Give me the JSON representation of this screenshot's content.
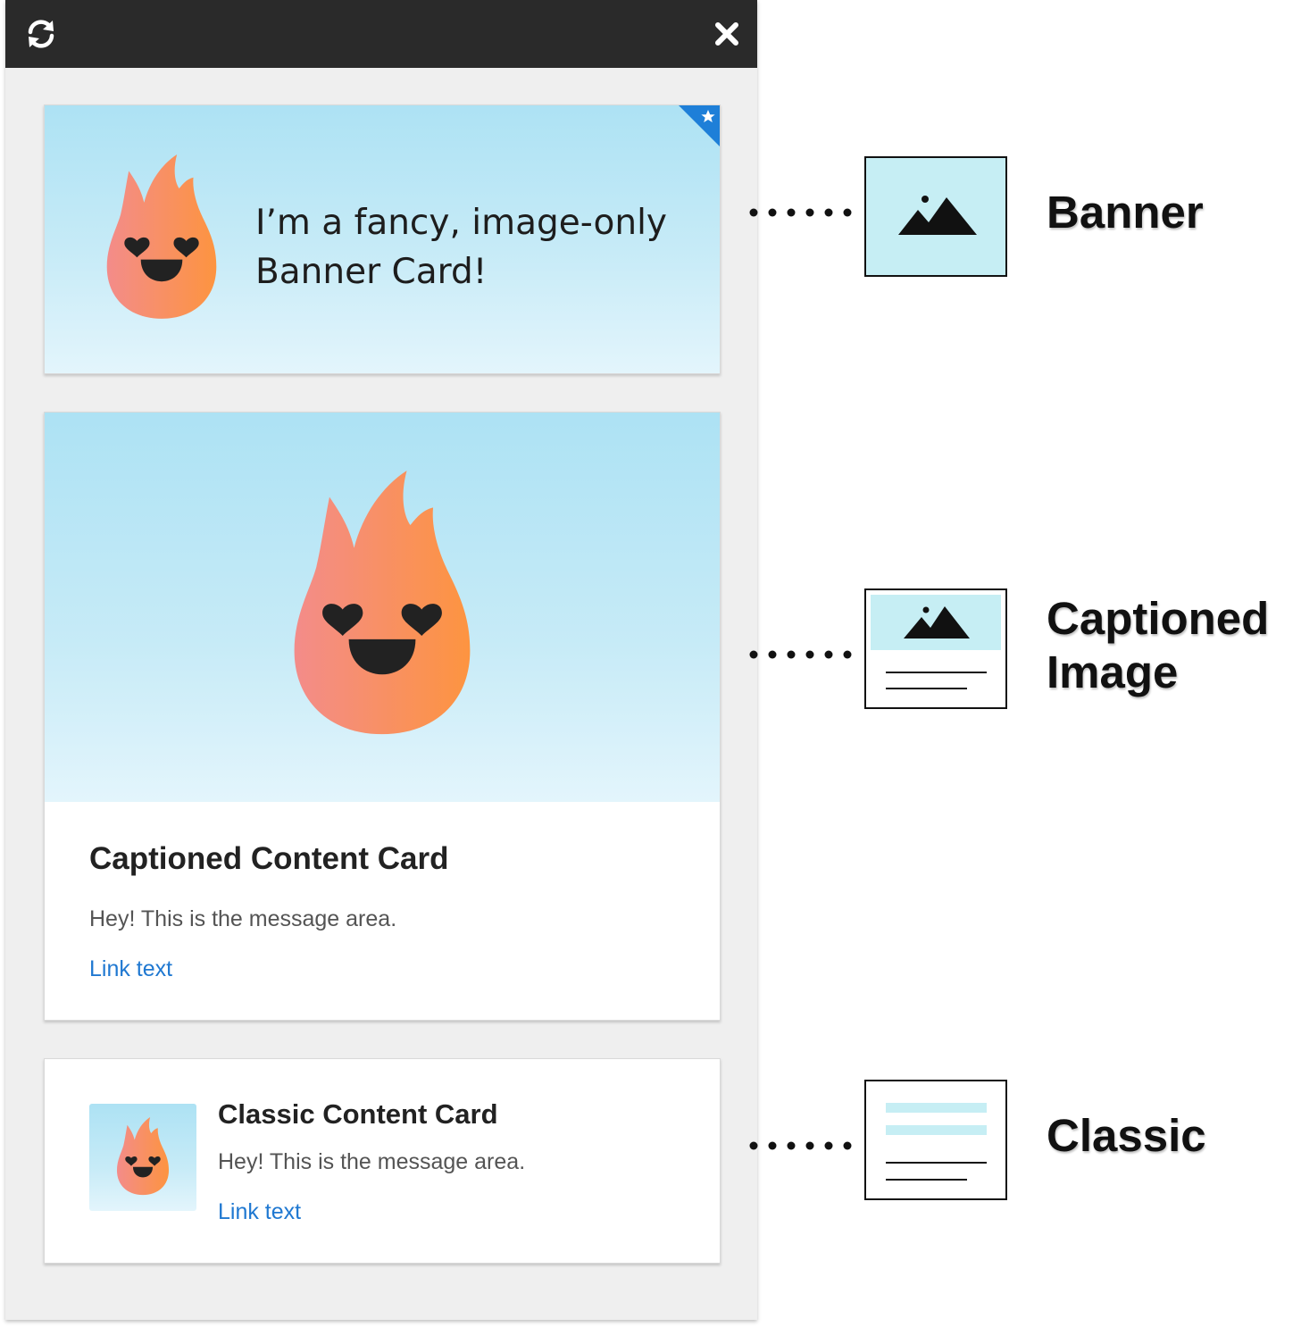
{
  "toolbar": {
    "refresh_icon": "refresh-icon",
    "close_icon": "close-icon"
  },
  "cards": {
    "banner": {
      "text": "I’m a fancy, image-only\nBanner Card!",
      "pinned_icon": "star-icon"
    },
    "captioned": {
      "title": "Captioned Content Card",
      "message": "Hey! This is the message area.",
      "link": "Link text"
    },
    "classic": {
      "title": "Classic Content Card",
      "message": "Hey! This is the message area.",
      "link": "Link text"
    }
  },
  "legend": {
    "banner_label": "Banner",
    "captioned_label": "Captioned\nImage",
    "classic_label": "Classic"
  },
  "colors": {
    "header_bg": "#2a2a2a",
    "panel_bg": "#efefef",
    "link": "#1f78d1",
    "pin_corner": "#1e7fd8",
    "image_bg": "#ade2f4",
    "flame_start": "#f28a8a",
    "flame_end": "#fd9441"
  }
}
